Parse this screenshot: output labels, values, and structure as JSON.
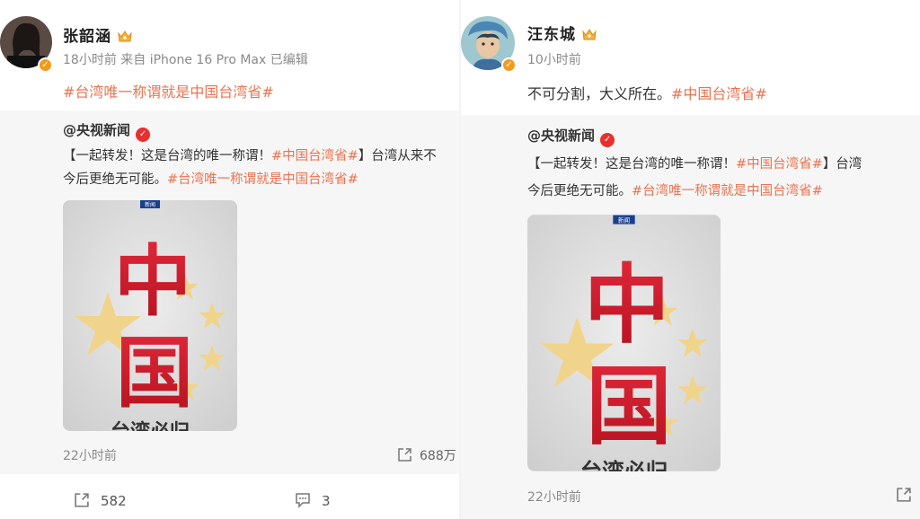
{
  "left_post": {
    "username": "张韶涵",
    "meta": "18小时前  来自 iPhone 16 Pro Max 已编辑",
    "text_tag": "#台湾唯一称谓就是中国台湾省#",
    "repost": {
      "author": "@央视新闻",
      "line1_a": "【一起转发！这是台湾的唯一称谓！",
      "line1_tag": "#中国台湾省#",
      "line1_b": "】台湾从来不",
      "line2_a": "今后更绝无可能。",
      "line2_tag": "#台湾唯一称谓就是中国台湾省#",
      "poster_tag": "新闻",
      "poster_chars": [
        "中",
        "国"
      ],
      "poster_bottom": "台湾必归",
      "time": "22小时前",
      "share_count": "688万"
    },
    "footer": {
      "forward_count": "582",
      "comment_count": "3"
    }
  },
  "right_post": {
    "username": "汪东城",
    "meta": "10小时前",
    "text_a": "不可分割，大义所在。",
    "text_tag": "#中国台湾省#",
    "repost": {
      "author": "@央视新闻",
      "line1_a": "【一起转发！这是台湾的唯一称谓！",
      "line1_tag": "#中国台湾省#",
      "line1_b": "】台湾",
      "line2_a": "今后更绝无可能。",
      "line2_tag": "#台湾唯一称谓就是中国台湾省#",
      "poster_tag": "新闻",
      "poster_chars": [
        "中",
        "国"
      ],
      "poster_bottom": "台湾必归",
      "time": "22小时前"
    }
  },
  "colors": {
    "tag": "#eb7350",
    "verified_orange": "#f29a1b",
    "verified_red": "#e8302f",
    "poster_red": "#d81e2b",
    "star_gold": "#f1d48b"
  }
}
